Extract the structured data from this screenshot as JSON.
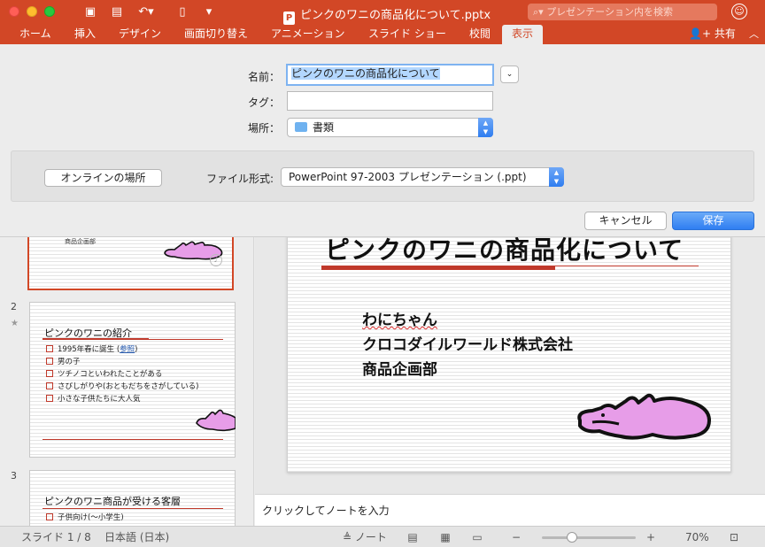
{
  "window": {
    "document_title": "ピンクのワニの商品化について.pptx",
    "search_placeholder": "プレゼンテーション内を検索",
    "colors": {
      "accent": "#d24726",
      "primary_button": "#2f7ef1"
    }
  },
  "ribbon": {
    "tabs": [
      "ホーム",
      "挿入",
      "デザイン",
      "画面切り替え",
      "アニメーション",
      "スライド ショー",
      "校閲",
      "表示"
    ],
    "active_tab": "表示",
    "share_label": "共有"
  },
  "save_dialog": {
    "name_label": "名前：",
    "name_value": "ピンクのワニの商品化について",
    "tags_label": "タグ：",
    "tags_value": "",
    "location_label": "場所：",
    "location_value": "書類",
    "online_locations_button": "オンラインの場所",
    "format_label": "ファイル形式:",
    "format_value": "PowerPoint 97-2003 プレゼンテーション (.ppt)",
    "cancel_button": "キャンセル",
    "save_button": "保存"
  },
  "thumbnails": [
    {
      "number": "1",
      "subtitle_fragment": "商品企画部",
      "current": true
    },
    {
      "number": "2",
      "starred": true,
      "title": "ピンクのワニの紹介",
      "bullets": [
        "1995年春に誕生 (",
        "参照",
        ")",
        "男の子",
        "ツチノコといわれたことがある",
        "さびしがりや(おともだちをさがしている)",
        "小さな子供たちに大人気"
      ]
    },
    {
      "number": "3",
      "title": "ピンクのワニ商品が受ける客層",
      "bullets": [
        "子供向け(～小学生)"
      ]
    }
  ],
  "main_slide": {
    "title": "ピンクのワニの商品化について",
    "lines": [
      "わにちゃん",
      "クロコダイルワールド株式会社",
      "商品企画部"
    ]
  },
  "notes_placeholder": "クリックしてノートを入力",
  "status_bar": {
    "slide_indicator": "スライド 1 / 8",
    "language": "日本語 (日本)",
    "notes_label": "ノート",
    "zoom": "70%",
    "zoom_level_fraction": 0.3
  }
}
